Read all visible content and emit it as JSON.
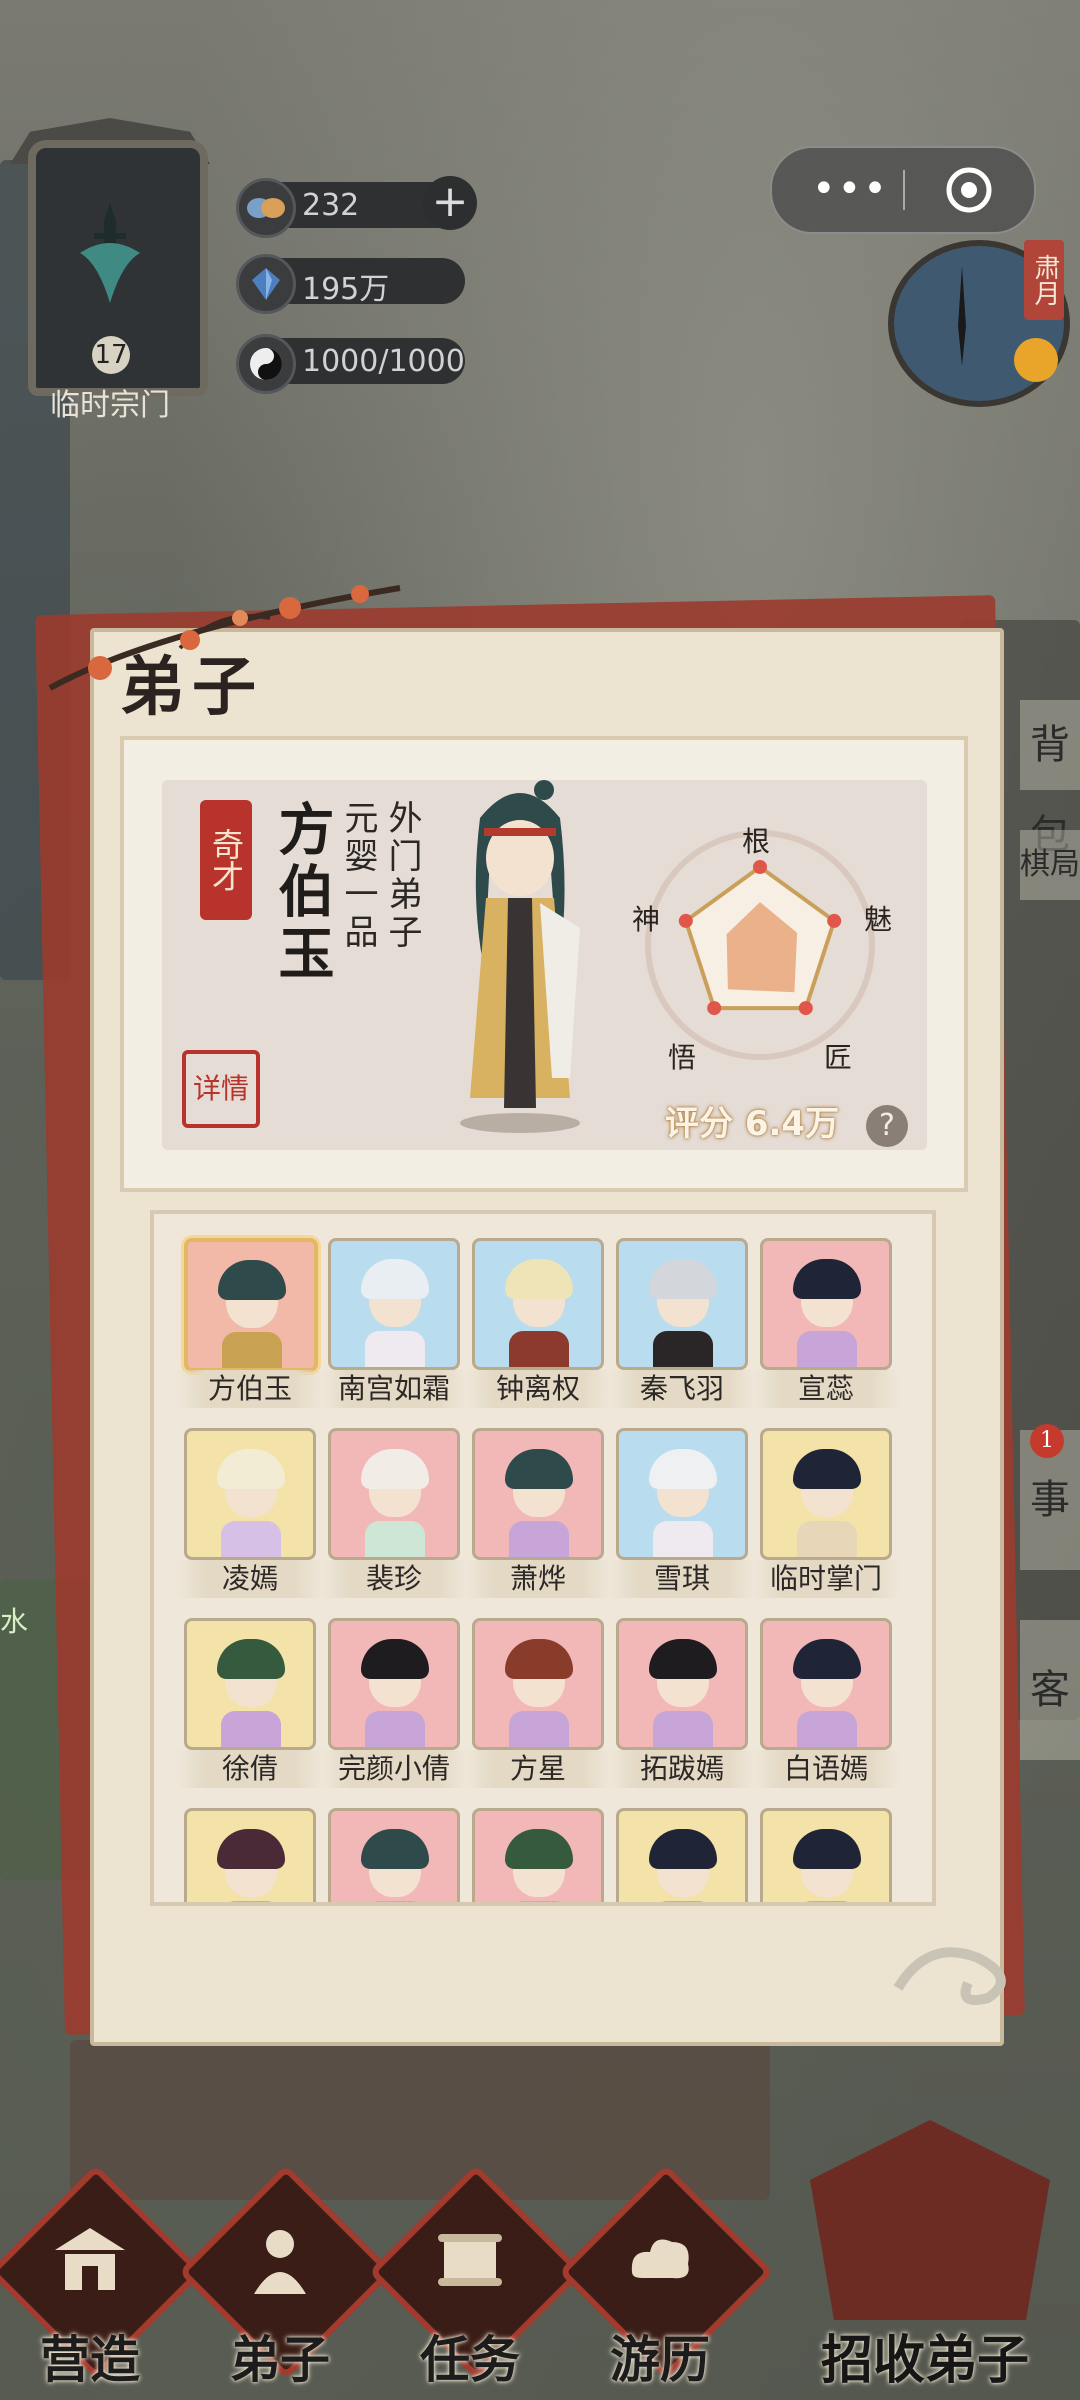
{
  "sect": {
    "level": "17",
    "name": "临时宗门"
  },
  "resources": [
    {
      "icon": "spirit-stone-icon",
      "value": "232",
      "has_plus": true
    },
    {
      "icon": "crystal-icon",
      "value": "195万",
      "has_plus": false
    },
    {
      "icon": "yin-yang-icon",
      "value": "1000/1000",
      "has_plus": false
    }
  ],
  "capsule": {
    "more": "•••"
  },
  "clock": {
    "season_tag": "肃月"
  },
  "side_menu": {
    "bag": "背包",
    "chess": "棋局",
    "events": "事",
    "events_badge": "1",
    "guest": "客",
    "water": "水"
  },
  "panel": {
    "title": "弟子"
  },
  "disciple": {
    "rank_tag": "奇才",
    "name": "方伯玉",
    "role": "外门弟子",
    "realm": "元婴一品",
    "detail_label": "详情",
    "radar_labels": {
      "top": "根",
      "right": "魅",
      "bottom_right": "匠",
      "bottom_left": "悟",
      "left": "神"
    },
    "radar_values": [
      0.55,
      0.5,
      0.75,
      0.7,
      0.45
    ],
    "score_label": "评分",
    "score_value": "6.4万",
    "help": "?"
  },
  "roster": [
    {
      "name": "方伯玉",
      "bg": "#f2b8a8",
      "hair": "#2f4a4a",
      "body": "#c9a253",
      "selected": true
    },
    {
      "name": "南宫如霜",
      "bg": "#b9dcef",
      "hair": "#e9eef2",
      "body": "#efe9f0",
      "selected": false
    },
    {
      "name": "钟离权",
      "bg": "#b9dcef",
      "hair": "#efe3b8",
      "body": "#8d3a2e",
      "selected": false
    },
    {
      "name": "秦飞羽",
      "bg": "#b9dcef",
      "hair": "#d3d6da",
      "body": "#2a2627",
      "selected": false
    },
    {
      "name": "宣蕊",
      "bg": "#f2b8b8",
      "hair": "#1f2436",
      "body": "#c7a5d8",
      "selected": false
    },
    {
      "name": "凌嫣",
      "bg": "#f3e3a8",
      "hair": "#f3ecd5",
      "body": "#d7c0e6",
      "selected": false
    },
    {
      "name": "裴珍",
      "bg": "#f2b8b8",
      "hair": "#f2ece6",
      "body": "#cde6d6",
      "selected": false
    },
    {
      "name": "萧烨",
      "bg": "#f2b8b8",
      "hair": "#2f4a4a",
      "body": "#c7a5d8",
      "selected": false
    },
    {
      "name": "雪琪",
      "bg": "#b9dcef",
      "hair": "#eef0f2",
      "body": "#efe9f0",
      "selected": false
    },
    {
      "name": "临时掌门",
      "bg": "#f3e3a8",
      "hair": "#1f2436",
      "body": "#e7d7b8",
      "selected": false
    },
    {
      "name": "徐倩",
      "bg": "#f3e3a8",
      "hair": "#355a3e",
      "body": "#c7a5d8",
      "selected": false
    },
    {
      "name": "完颜小倩",
      "bg": "#f2b8b8",
      "hair": "#1f1c20",
      "body": "#c7a5d8",
      "selected": false
    },
    {
      "name": "方星",
      "bg": "#f2b8b8",
      "hair": "#8a3c2a",
      "body": "#c7a5d8",
      "selected": false
    },
    {
      "name": "拓跋嫣",
      "bg": "#f2b8b8",
      "hair": "#1f1c20",
      "body": "#c7a5d8",
      "selected": false
    },
    {
      "name": "白语嫣",
      "bg": "#f2b8b8",
      "hair": "#1f2436",
      "body": "#c7a5d8",
      "selected": false
    },
    {
      "name": "",
      "bg": "#f3e3a8",
      "hair": "#4a2a36",
      "body": "#c7a5d8",
      "selected": false
    },
    {
      "name": "",
      "bg": "#f2b8b8",
      "hair": "#2f4a4a",
      "body": "#c7a5d8",
      "selected": false
    },
    {
      "name": "",
      "bg": "#f2b8b8",
      "hair": "#355a3e",
      "body": "#c7a5d8",
      "selected": false
    },
    {
      "name": "",
      "bg": "#f3e3a8",
      "hair": "#1f2436",
      "body": "#c7a5d8",
      "selected": false
    },
    {
      "name": "",
      "bg": "#f3e3a8",
      "hair": "#1f2436",
      "body": "#c7a5d8",
      "selected": false
    }
  ],
  "nav": [
    {
      "label": "营造",
      "icon": "building-icon"
    },
    {
      "label": "弟子",
      "icon": "disciple-icon"
    },
    {
      "label": "任务",
      "icon": "scroll-icon"
    },
    {
      "label": "游历",
      "icon": "cloud-icon"
    }
  ],
  "recruit": {
    "label": "招收弟子"
  }
}
